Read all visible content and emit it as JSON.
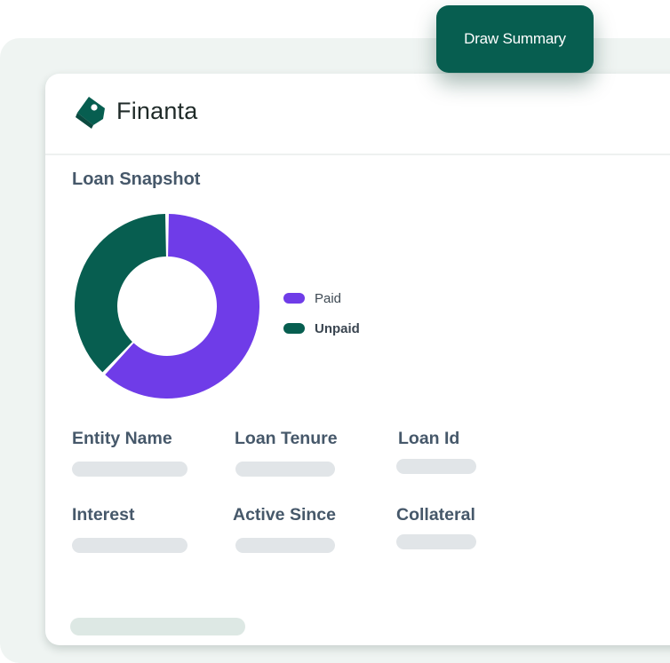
{
  "brand": {
    "name": "Finanta",
    "logo_icon": "tag-icon",
    "color": "#075e50"
  },
  "action": {
    "draw_summary_label": "Draw Summary"
  },
  "snapshot": {
    "title": "Loan Snapshot",
    "legend": [
      {
        "label": "Paid",
        "color": "#6f3ce8"
      },
      {
        "label": "Unpaid",
        "color": "#075e50"
      }
    ]
  },
  "chart_data": {
    "type": "pie",
    "variant": "donut",
    "labels": [
      "Paid",
      "Unpaid"
    ],
    "values": [
      62,
      38
    ],
    "colors": [
      "#6f3ce8",
      "#075e50"
    ]
  },
  "fields": {
    "entity_name": "Entity Name",
    "loan_tenure": "Loan Tenure",
    "loan_id": "Loan Id",
    "interest": "Interest",
    "active_since": "Active Since",
    "collateral": "Collateral"
  }
}
